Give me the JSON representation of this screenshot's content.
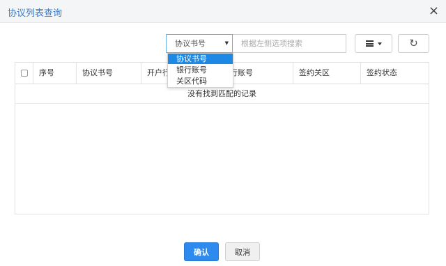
{
  "dialog": {
    "title": "协议列表查询",
    "close_label": "×"
  },
  "toolbar": {
    "field_select_value": "协议书号",
    "search_placeholder": "根据左侧选项搜索",
    "columns_icon": "list-icon",
    "refresh_icon": "refresh-icon",
    "refresh_glyph": "↻"
  },
  "dropdown": {
    "options": [
      "协议书号",
      "银行账号",
      "关区代码"
    ],
    "selected_index": 0
  },
  "table": {
    "columns": [
      "序号",
      "协议书号",
      "开户行",
      "银行账号",
      "签约关区",
      "签约状态"
    ],
    "empty_message": "没有找到匹配的记录"
  },
  "footer": {
    "confirm_label": "确认",
    "cancel_label": "取消"
  },
  "colors": {
    "title": "#3a7bc8",
    "primary": "#2d8bf0",
    "selected_option": "#1e88e5"
  }
}
